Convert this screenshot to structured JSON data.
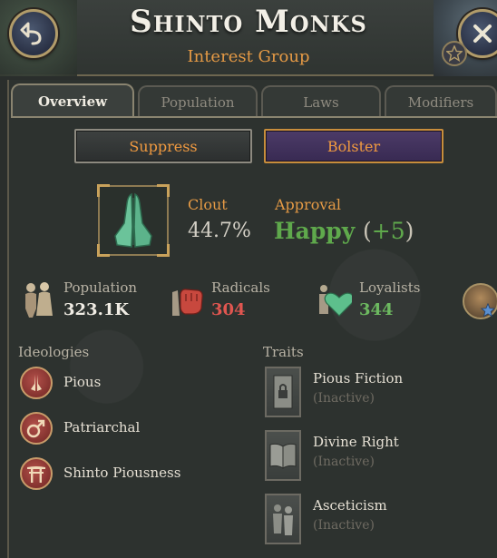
{
  "header": {
    "title": "Shinto Monks",
    "subtitle": "Interest Group"
  },
  "tabs": [
    {
      "label": "Overview",
      "active": true
    },
    {
      "label": "Population",
      "active": false
    },
    {
      "label": "Laws",
      "active": false
    },
    {
      "label": "Modifiers",
      "active": false
    }
  ],
  "actions": {
    "suppress_label": "Suppress",
    "bolster_label": "Bolster"
  },
  "summary": {
    "clout_label": "Clout",
    "clout_value": "44.7%",
    "approval_label": "Approval",
    "approval_state": "Happy",
    "approval_delta": "+5"
  },
  "stats": {
    "population_label": "Population",
    "population_value": "323.1K",
    "radicals_label": "Radicals",
    "radicals_value": "304",
    "loyalists_label": "Loyalists",
    "loyalists_value": "344"
  },
  "ideologies": {
    "heading": "Ideologies",
    "items": [
      {
        "name": "Pious",
        "icon": "praying-hands-icon"
      },
      {
        "name": "Patriarchal",
        "icon": "male-symbol-icon"
      },
      {
        "name": "Shinto Piousness",
        "icon": "torii-gate-icon"
      }
    ]
  },
  "traits": {
    "heading": "Traits",
    "items": [
      {
        "name": "Pious Fiction",
        "status": "(Inactive)",
        "icon": "locked-scroll-icon"
      },
      {
        "name": "Divine Right",
        "status": "(Inactive)",
        "icon": "open-book-icon"
      },
      {
        "name": "Asceticism",
        "status": "(Inactive)",
        "icon": "figures-icon"
      }
    ]
  },
  "colors": {
    "accent_orange": "#e59a45",
    "happy_green": "#5fa94c",
    "radical_red": "#e05650",
    "loyal_green": "#6db960",
    "bolster_purple": "#4c3b68"
  }
}
